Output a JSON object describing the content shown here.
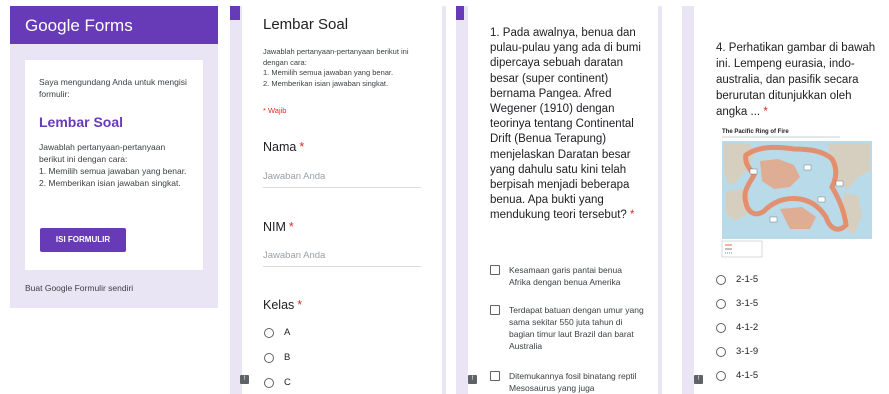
{
  "email": {
    "brand": "Google Forms",
    "invite": "Saya mengundang Anda untuk mengisi formulir:",
    "form_title": "Lembar Soal",
    "form_description": "Jawablah pertanyaan-pertanyaan berikut ini dengan cara:\n1. Memilih semua jawaban yang benar.\n2. Memberikan isian jawaban singkat.",
    "fill_button": "ISI FORMULIR",
    "footer_link": "Buat Google Formulir sendiri"
  },
  "form": {
    "title": "Lembar Soal",
    "description": "Jawablah pertanyaan-pertanyaan berikut ini dengan cara:\n1. Memilih semua jawaban yang benar.\n2. Memberikan isian jawaban singkat.",
    "required_note": "* Wajib",
    "fields": {
      "nama": {
        "label": "Nama",
        "placeholder": "Jawaban Anda"
      },
      "nim": {
        "label": "NIM",
        "placeholder": "Jawaban Anda"
      },
      "kelas": {
        "label": "Kelas",
        "options": [
          "A",
          "B",
          "C"
        ]
      }
    }
  },
  "question1": {
    "text": "1. Pada awalnya, benua dan pulau-pulau yang ada di bumi dipercaya sebuah daratan besar (super continent) bernama Pangea. Afred Wegener (1910) dengan teorinya tentang Continental Drift (Benua Terapung) menjelaskan Daratan besar yang dahulu satu kini telah berpisah menjadi beberapa benua. Apa bukti yang mendukung teori tersebut?",
    "options": [
      "Kesamaan garis pantai benua Afrika dengan benua Amerika",
      "Terdapat batuan dengan umur yang sama sekitar 550 juta tahun di bagian timur laut Brazil dan barat Australia",
      "Ditemukannya fosil binatang reptil Mesosaurus yang juga"
    ]
  },
  "question4": {
    "text": "4. Perhatikan gambar di bawah ini. Lempeng eurasia, indo-australia, dan pasifik secara berurutan ditunjukkan oleh angka ...",
    "map_title": "The Pacific Ring of Fire",
    "options": [
      "2-1-5",
      "3-1-5",
      "4-1-2",
      "3-1-9",
      "4-1-5"
    ]
  },
  "colors": {
    "accent": "#673ab7",
    "background": "#e9e5f5",
    "required": "#d93025"
  }
}
